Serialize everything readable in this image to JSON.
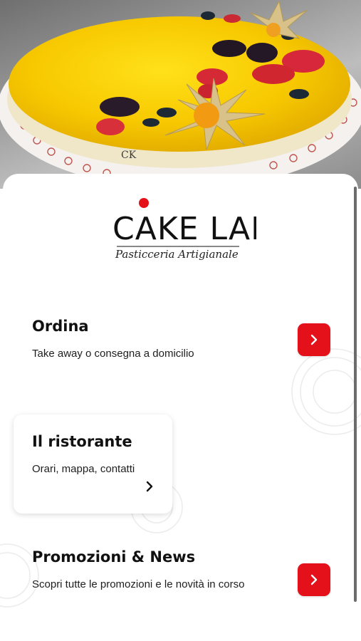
{
  "brand": {
    "name": "CAKE LAB",
    "tagline": "Pasticceria Artigianale",
    "accent_color": "#e4101a"
  },
  "hero": {
    "image": "cake-photo",
    "image_text": "CK"
  },
  "sections": [
    {
      "title": "Ordina",
      "subtitle": "Take away o consegna a domicilio",
      "action_icon": "chevron-right-icon"
    },
    {
      "title": "Il ristorante",
      "subtitle": "Orari, mappa, contatti",
      "action_icon": "chevron-right-icon"
    },
    {
      "title": "Promozioni & News",
      "subtitle": "Scopri tutte le promozioni e le novità in corso",
      "action_icon": "chevron-right-icon"
    }
  ]
}
